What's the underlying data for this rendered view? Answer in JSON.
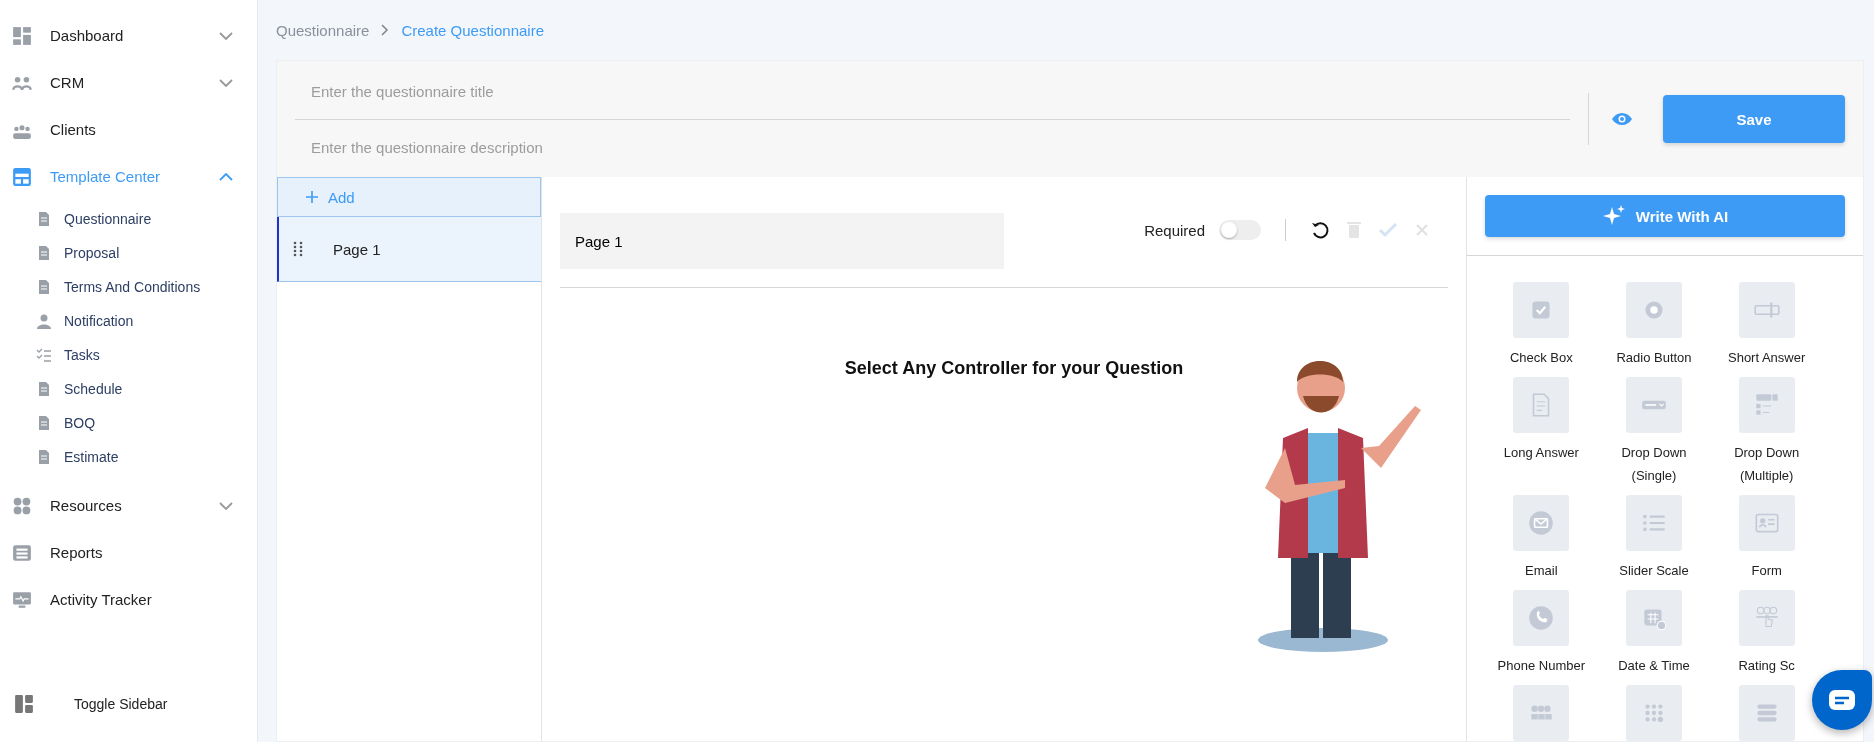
{
  "sidebar": {
    "items": [
      {
        "label": "Dashboard",
        "selected": false,
        "expanded": false
      },
      {
        "label": "CRM",
        "selected": false,
        "expanded": false
      },
      {
        "label": "Clients",
        "selected": false
      },
      {
        "label": "Template Center",
        "selected": true,
        "expanded": true,
        "children": [
          {
            "label": "Questionnaire",
            "selected": false
          },
          {
            "label": "Proposal",
            "selected": false
          },
          {
            "label": "Terms And Conditions",
            "selected": false
          },
          {
            "label": "Notification",
            "selected": false
          },
          {
            "label": "Tasks",
            "selected": false
          },
          {
            "label": "Schedule",
            "selected": false
          },
          {
            "label": "BOQ",
            "selected": false
          },
          {
            "label": "Estimate",
            "selected": false
          }
        ]
      },
      {
        "label": "Resources",
        "selected": false,
        "expanded": false
      },
      {
        "label": "Reports",
        "selected": false
      },
      {
        "label": "Activity Tracker",
        "selected": false
      }
    ],
    "toggle_label": "Toggle Sidebar"
  },
  "breadcrumb": [
    {
      "label": "Questionnaire",
      "selected": false
    },
    {
      "label": "Create Questionnaire",
      "selected": true
    }
  ],
  "form": {
    "title_placeholder": "Enter the questionnaire title",
    "description_placeholder": "Enter the questionnaire description",
    "save_button": "Save"
  },
  "pages": {
    "add_button": "Add",
    "items": [
      {
        "label": "Page 1",
        "selected": true
      }
    ]
  },
  "editor": {
    "page_name": "Page 1",
    "required_label": "Required",
    "required": false,
    "prompt": "Select Any Controller for your Question"
  },
  "controls": {
    "write_ai_button": "Write With AI",
    "items": [
      {
        "label": "Check Box",
        "kind": "checkbox"
      },
      {
        "label": "Radio Button",
        "kind": "radio"
      },
      {
        "label": "Short Answer",
        "kind": "short"
      },
      {
        "label": "Long Answer",
        "kind": "long"
      },
      {
        "label": "Drop Down (Single)",
        "kind": "dropdown"
      },
      {
        "label": "Drop Down (Multiple)",
        "kind": "multi"
      },
      {
        "label": "Email",
        "kind": "email"
      },
      {
        "label": "Slider Scale",
        "kind": "slider"
      },
      {
        "label": "Form",
        "kind": "form"
      },
      {
        "label": "Phone Number",
        "kind": "phone"
      },
      {
        "label": "Date & Time",
        "kind": "date"
      },
      {
        "label": "Rating Sc",
        "kind": "rating"
      },
      {
        "kind": "emoji"
      },
      {
        "kind": "dots"
      },
      {
        "kind": "rows"
      }
    ]
  }
}
